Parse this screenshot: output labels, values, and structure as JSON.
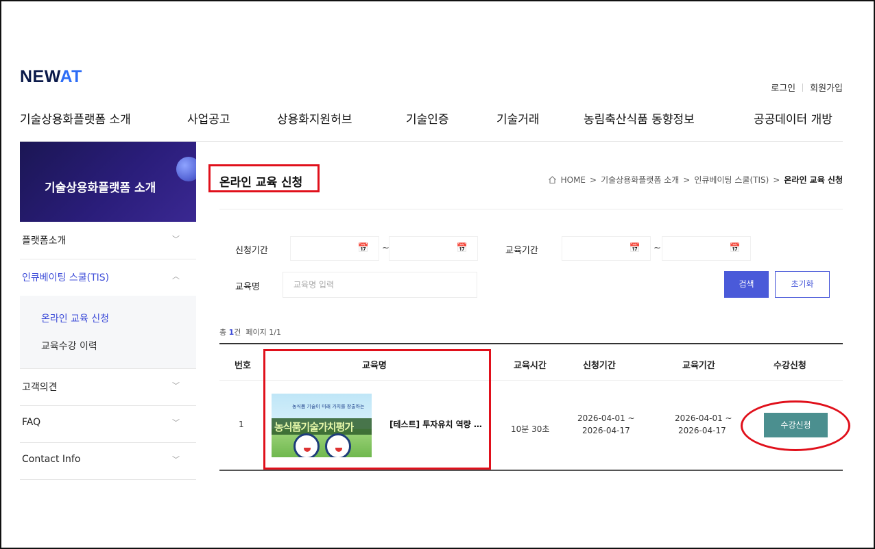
{
  "header": {
    "logo_main": "NEW",
    "logo_accent": "AT",
    "login": "로그인",
    "signup": "회원가입",
    "nav": [
      "기술상용화플랫폼 소개",
      "사업공고",
      "상용화지원허브",
      "기술인증",
      "기술거래",
      "농림축산식품 동향정보",
      "공공데이터 개방"
    ]
  },
  "sidebar": {
    "hero_title": "기술상용화플랫폼 소개",
    "items": [
      {
        "label": "플랫폼소개",
        "chevron": "﹀"
      },
      {
        "label": "인큐베이팅 스쿨(TIS)",
        "chevron": "︿"
      },
      {
        "label": "고객의견",
        "chevron": "﹀"
      },
      {
        "label": "FAQ",
        "chevron": "﹀"
      },
      {
        "label": "Contact Info",
        "chevron": "﹀"
      }
    ],
    "sub_items": [
      "온라인 교육 신청",
      "교육수강 이력"
    ]
  },
  "page": {
    "title": "온라인 교육 신청",
    "breadcrumb": [
      "HOME",
      ">",
      "기술상용화플랫폼 소개",
      ">",
      "인큐베이팅 스쿨(TIS)",
      ">",
      "온라인 교육 신청"
    ]
  },
  "search": {
    "apply_period_label": "신청기간",
    "edu_period_label": "교육기간",
    "edu_name_label": "교육명",
    "edu_name_placeholder": "교육명 입력",
    "tilde": "~",
    "search_button": "검색",
    "reset_button": "초기화"
  },
  "summary": {
    "total_prefix": "총",
    "total_count": "1",
    "total_suffix": "건",
    "page_info": "페이지 1/1"
  },
  "table": {
    "headers": [
      "번호",
      "교육명",
      "교육시간",
      "신청기간",
      "교육기간",
      "수강신청"
    ],
    "rows": [
      {
        "no": "1",
        "title": "[테스트] 투자유치 역량 강화",
        "thumb_caption_small": "농식품 기술이 미래 가치를 창출하는",
        "thumb_caption": "농식품기술가치평가",
        "duration": "10분 30초",
        "apply_start": "2026-04-01 ~",
        "apply_end": "2026-04-17",
        "edu_start": "2026-04-01 ~",
        "edu_end": "2026-04-17",
        "apply_button": "수강신청"
      }
    ]
  },
  "icons": {
    "calendar": "calendar-icon",
    "home": "home-icon",
    "chevron": "chevron-icon"
  },
  "colors": {
    "primary": "#4a5ad9",
    "apply_button": "#4b8f8f",
    "highlight": "#e0101b",
    "sidebar_hero": "#1b1654"
  }
}
